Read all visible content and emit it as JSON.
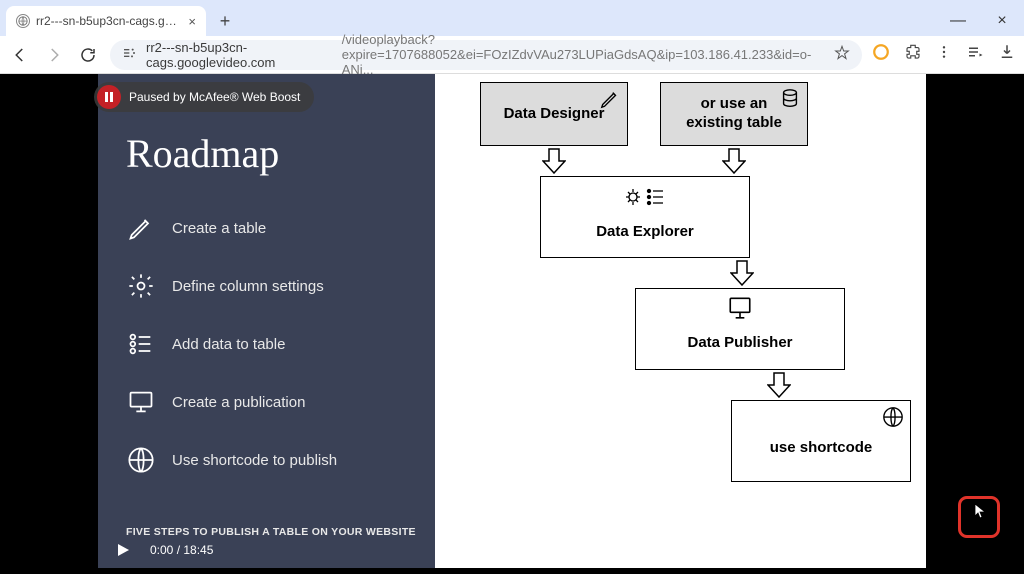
{
  "browser": {
    "tab_title": "rr2---sn-b5up3cn-cags.googlev",
    "url_host": "rr2---sn-b5up3cn-cags.googlevideo.com",
    "url_path": "/videoplayback?expire=1707688052&ei=FOzIZdvVAu273LUPiaGdsAQ&ip=103.186.41.233&id=o-ANi..."
  },
  "overlay": {
    "pause_text": "Paused by McAfee® Web Boost"
  },
  "slide": {
    "title": "Roadmap",
    "steps": [
      {
        "label": "Create a table"
      },
      {
        "label": "Define column settings"
      },
      {
        "label": "Add data to table"
      },
      {
        "label": "Create a publication"
      },
      {
        "label": "Use shortcode to publish"
      }
    ],
    "footer": "FIVE STEPS TO PUBLISH A TABLE ON YOUR WEBSITE"
  },
  "diagram": {
    "designer": "Data Designer",
    "existing": "or use an\nexisting table",
    "explorer": "Data Explorer",
    "publisher": "Data Publisher",
    "shortcode": "use shortcode"
  },
  "player": {
    "time": "0:00 / 18:45"
  }
}
